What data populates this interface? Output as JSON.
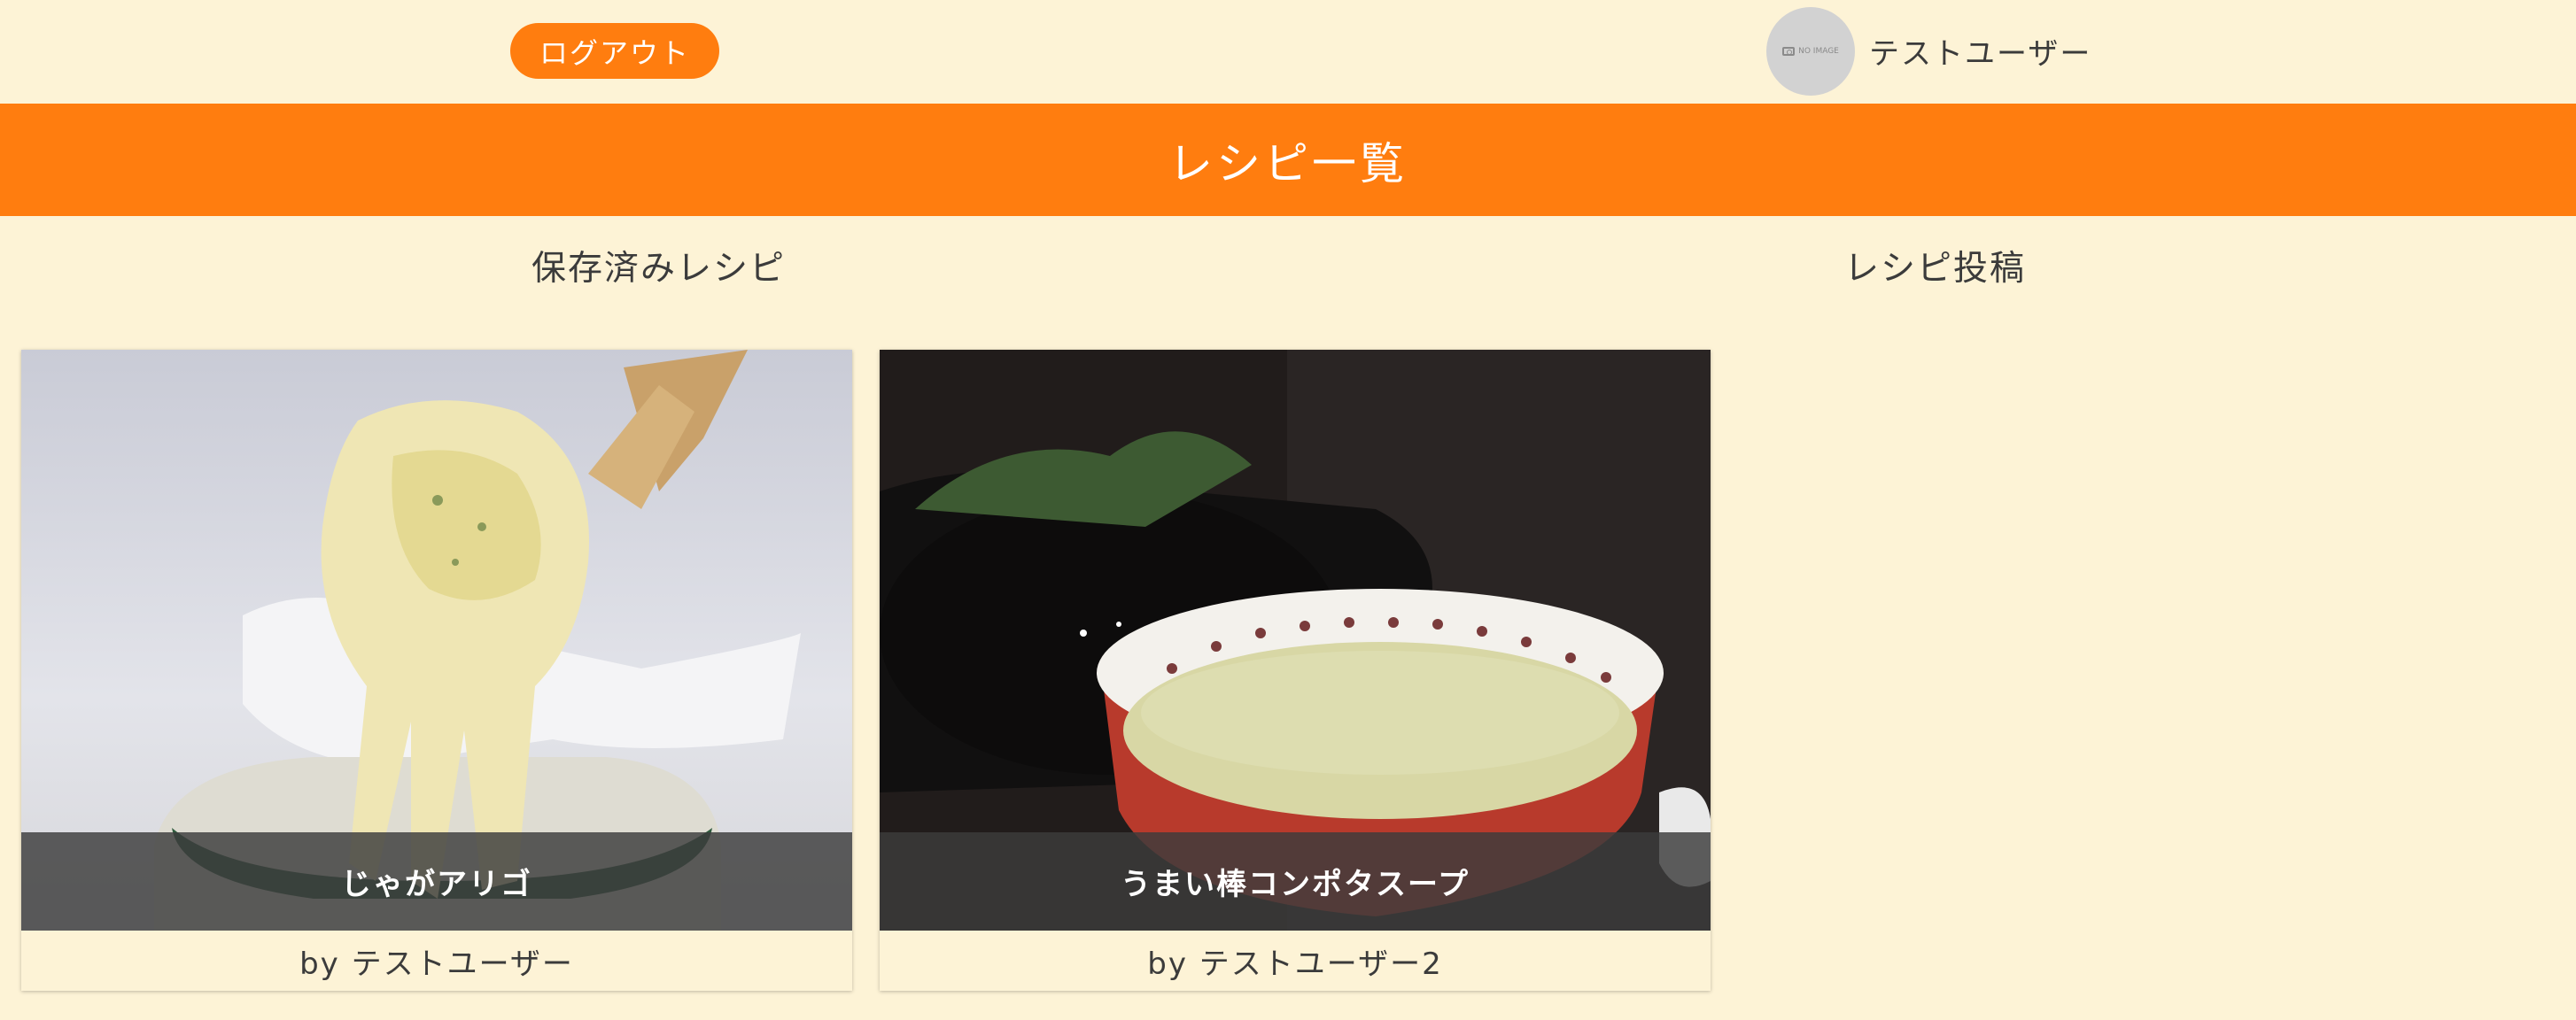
{
  "header": {
    "logout_label": "ログアウト",
    "avatar_text": "NO IMAGE",
    "username": "テストユーザー",
    "page_title": "レシピ一覧"
  },
  "nav": {
    "saved_label": "保存済みレシピ",
    "post_label": "レシピ投稿"
  },
  "recipes": [
    {
      "title": "じゃがアリゴ",
      "author": "by テストユーザー"
    },
    {
      "title": "うまい棒コンポタスープ",
      "author": "by テストユーザー2"
    }
  ],
  "colors": {
    "accent": "#ff7d0f",
    "background": "#fdf3d6"
  }
}
